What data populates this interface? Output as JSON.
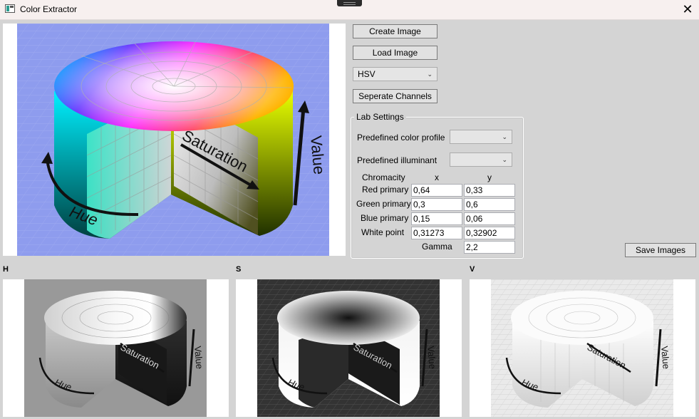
{
  "window": {
    "title": "Color Extractor",
    "close_glyph": "✕"
  },
  "buttons": {
    "create_image": "Create Image",
    "load_image": "Load Image",
    "separate_channels": "Seperate Channels",
    "save_images": "Save Images"
  },
  "colorspace_select": {
    "selected": "HSV"
  },
  "lab_settings": {
    "legend": "Lab Settings",
    "predefined_color_profile_label": "Predefined color profile",
    "predefined_color_profile_value": "",
    "predefined_illuminant_label": "Predefined illuminant",
    "predefined_illuminant_value": "",
    "chromacity_label": "Chromacity",
    "col_x": "x",
    "col_y": "y",
    "rows": [
      {
        "label": "Red primary",
        "x": "0,64",
        "y": "0,33"
      },
      {
        "label": "Green primary",
        "x": "0,3",
        "y": "0,6"
      },
      {
        "label": "Blue primary",
        "x": "0,15",
        "y": "0,06"
      },
      {
        "label": "White point",
        "x": "0,31273",
        "y": "0,32902"
      }
    ],
    "gamma_label": "Gamma",
    "gamma_value": "2,2"
  },
  "image_labels": {
    "hue": "Hue",
    "saturation": "Saturation",
    "value": "Value"
  },
  "channels": {
    "h": "H",
    "s": "S",
    "v": "V"
  },
  "colors": {
    "window_bg": "#d4d4d4",
    "preview_bg": "#8e9cee",
    "h_bg": "#999999",
    "s_bg": "#333333",
    "v_bg": "#eaeaea"
  }
}
